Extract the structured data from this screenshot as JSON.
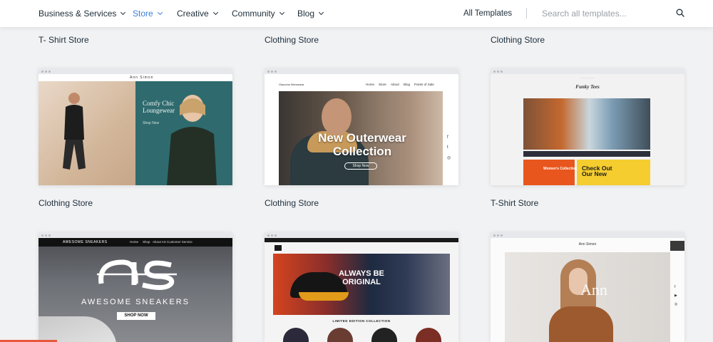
{
  "nav": {
    "items": [
      {
        "label": "Business & Services",
        "active": false
      },
      {
        "label": "Store",
        "active": true
      },
      {
        "label": "Creative",
        "active": false
      },
      {
        "label": "Community",
        "active": false
      },
      {
        "label": "Blog",
        "active": false
      }
    ],
    "all_templates": "All Templates",
    "search_placeholder": "Search all templates...",
    "accent": "#3b7fd9"
  },
  "top_row_titles": [
    "T- Shirt Store",
    "Clothing Store",
    "Clothing Store"
  ],
  "cards": [
    {
      "title": "Clothing Store",
      "preview": {
        "logo": "Ann Simon",
        "headline": "Comfy Chic Loungewear",
        "link": "Shop Now"
      }
    },
    {
      "title": "Clothing Store",
      "preview": {
        "logo": "Giacomo Menswear",
        "nav": [
          "Home",
          "Store",
          "About",
          "Blog",
          "Points of Sale"
        ],
        "headline": "New Outerwear Collection",
        "button": "Shop Now"
      }
    },
    {
      "title": "T-Shirt Store",
      "preview": {
        "logo": "Funky Tees",
        "left_text": "Women's Collection",
        "right_text": "Check Out Our New"
      }
    },
    {
      "title": "",
      "preview": {
        "logo": "AWESOME SNEAKERS",
        "nav": [
          "Home",
          "Shop",
          "About AS",
          "Customer Service"
        ],
        "brand": "AWESOME SNEAKERS",
        "button": "SHOP NOW"
      }
    },
    {
      "title": "",
      "preview": {
        "headline": "ALWAYS BE ORIGINAL",
        "sub": "LIMITED EDITION COLLECTION"
      }
    },
    {
      "title": "",
      "preview": {
        "name": "Ann Simon",
        "monogram": "Ann"
      }
    }
  ]
}
